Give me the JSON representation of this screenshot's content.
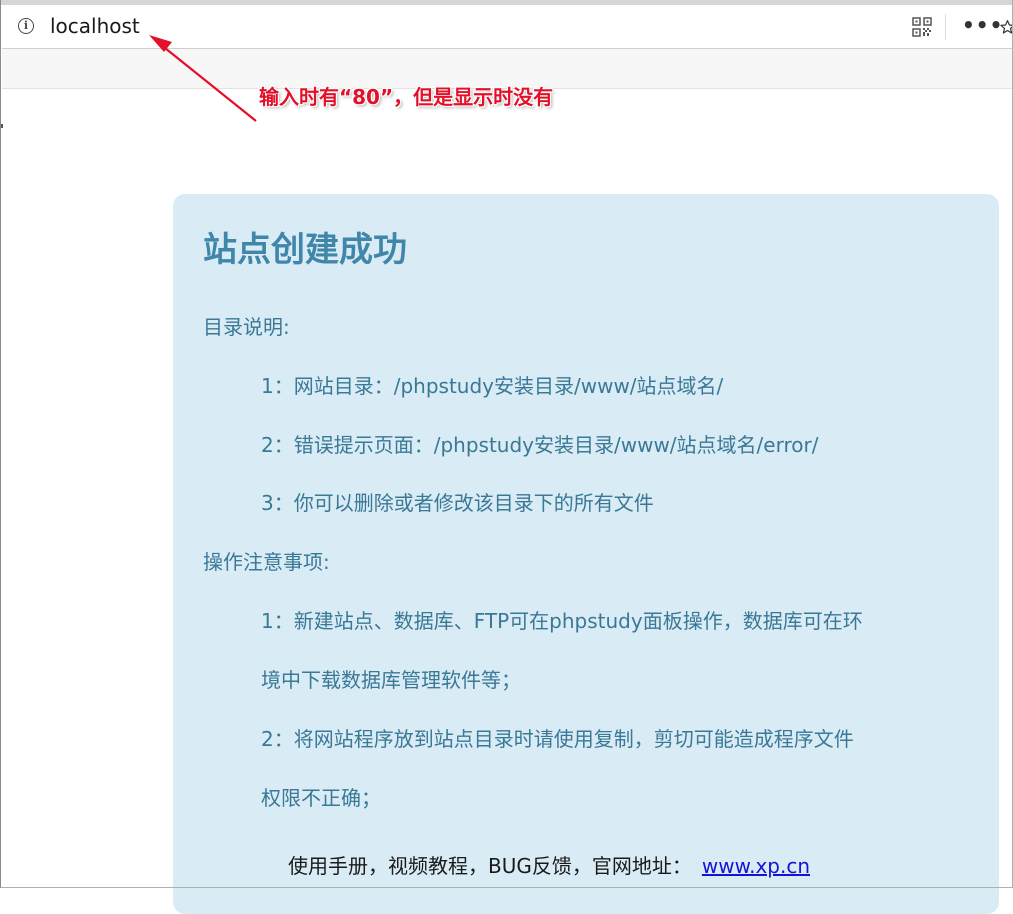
{
  "browser": {
    "url": "localhost",
    "icons": {
      "info": "info-icon",
      "qr": "qr-code-icon",
      "more": "more-options-icon",
      "star": "bookmark-star-icon"
    },
    "more_glyph": "•••",
    "info_glyph": "i"
  },
  "annotation": {
    "text": "输入时有“80”，但是显示时没有",
    "color": "#e3102a"
  },
  "page": {
    "title": "站点创建成功",
    "dir_heading": "目录说明:",
    "dir_items": [
      "1：网站目录：/phpstudy安装目录/www/站点域名/",
      "2：错误提示页面：/phpstudy安装目录/www/站点域名/error/",
      "3：你可以删除或者修改该目录下的所有文件"
    ],
    "notes_heading": "操作注意事项:",
    "notes": [
      {
        "line1": "1：新建站点、数据库、FTP可在phpstudy面板操作，数据库可在环",
        "line2": "境中下载数据库管理软件等；"
      },
      {
        "line1": "2：将网站程序放到站点目录时请使用复制，剪切可能造成程序文件",
        "line2": "权限不正确；"
      }
    ],
    "footer_text": "使用手册，视频教程，BUG反馈，官网地址：",
    "footer_link": "www.xp.cn"
  },
  "colors": {
    "card_bg": "#d9ecf6",
    "title": "#3f86a9",
    "body_text": "#3b7896",
    "link": "#1414d6"
  }
}
